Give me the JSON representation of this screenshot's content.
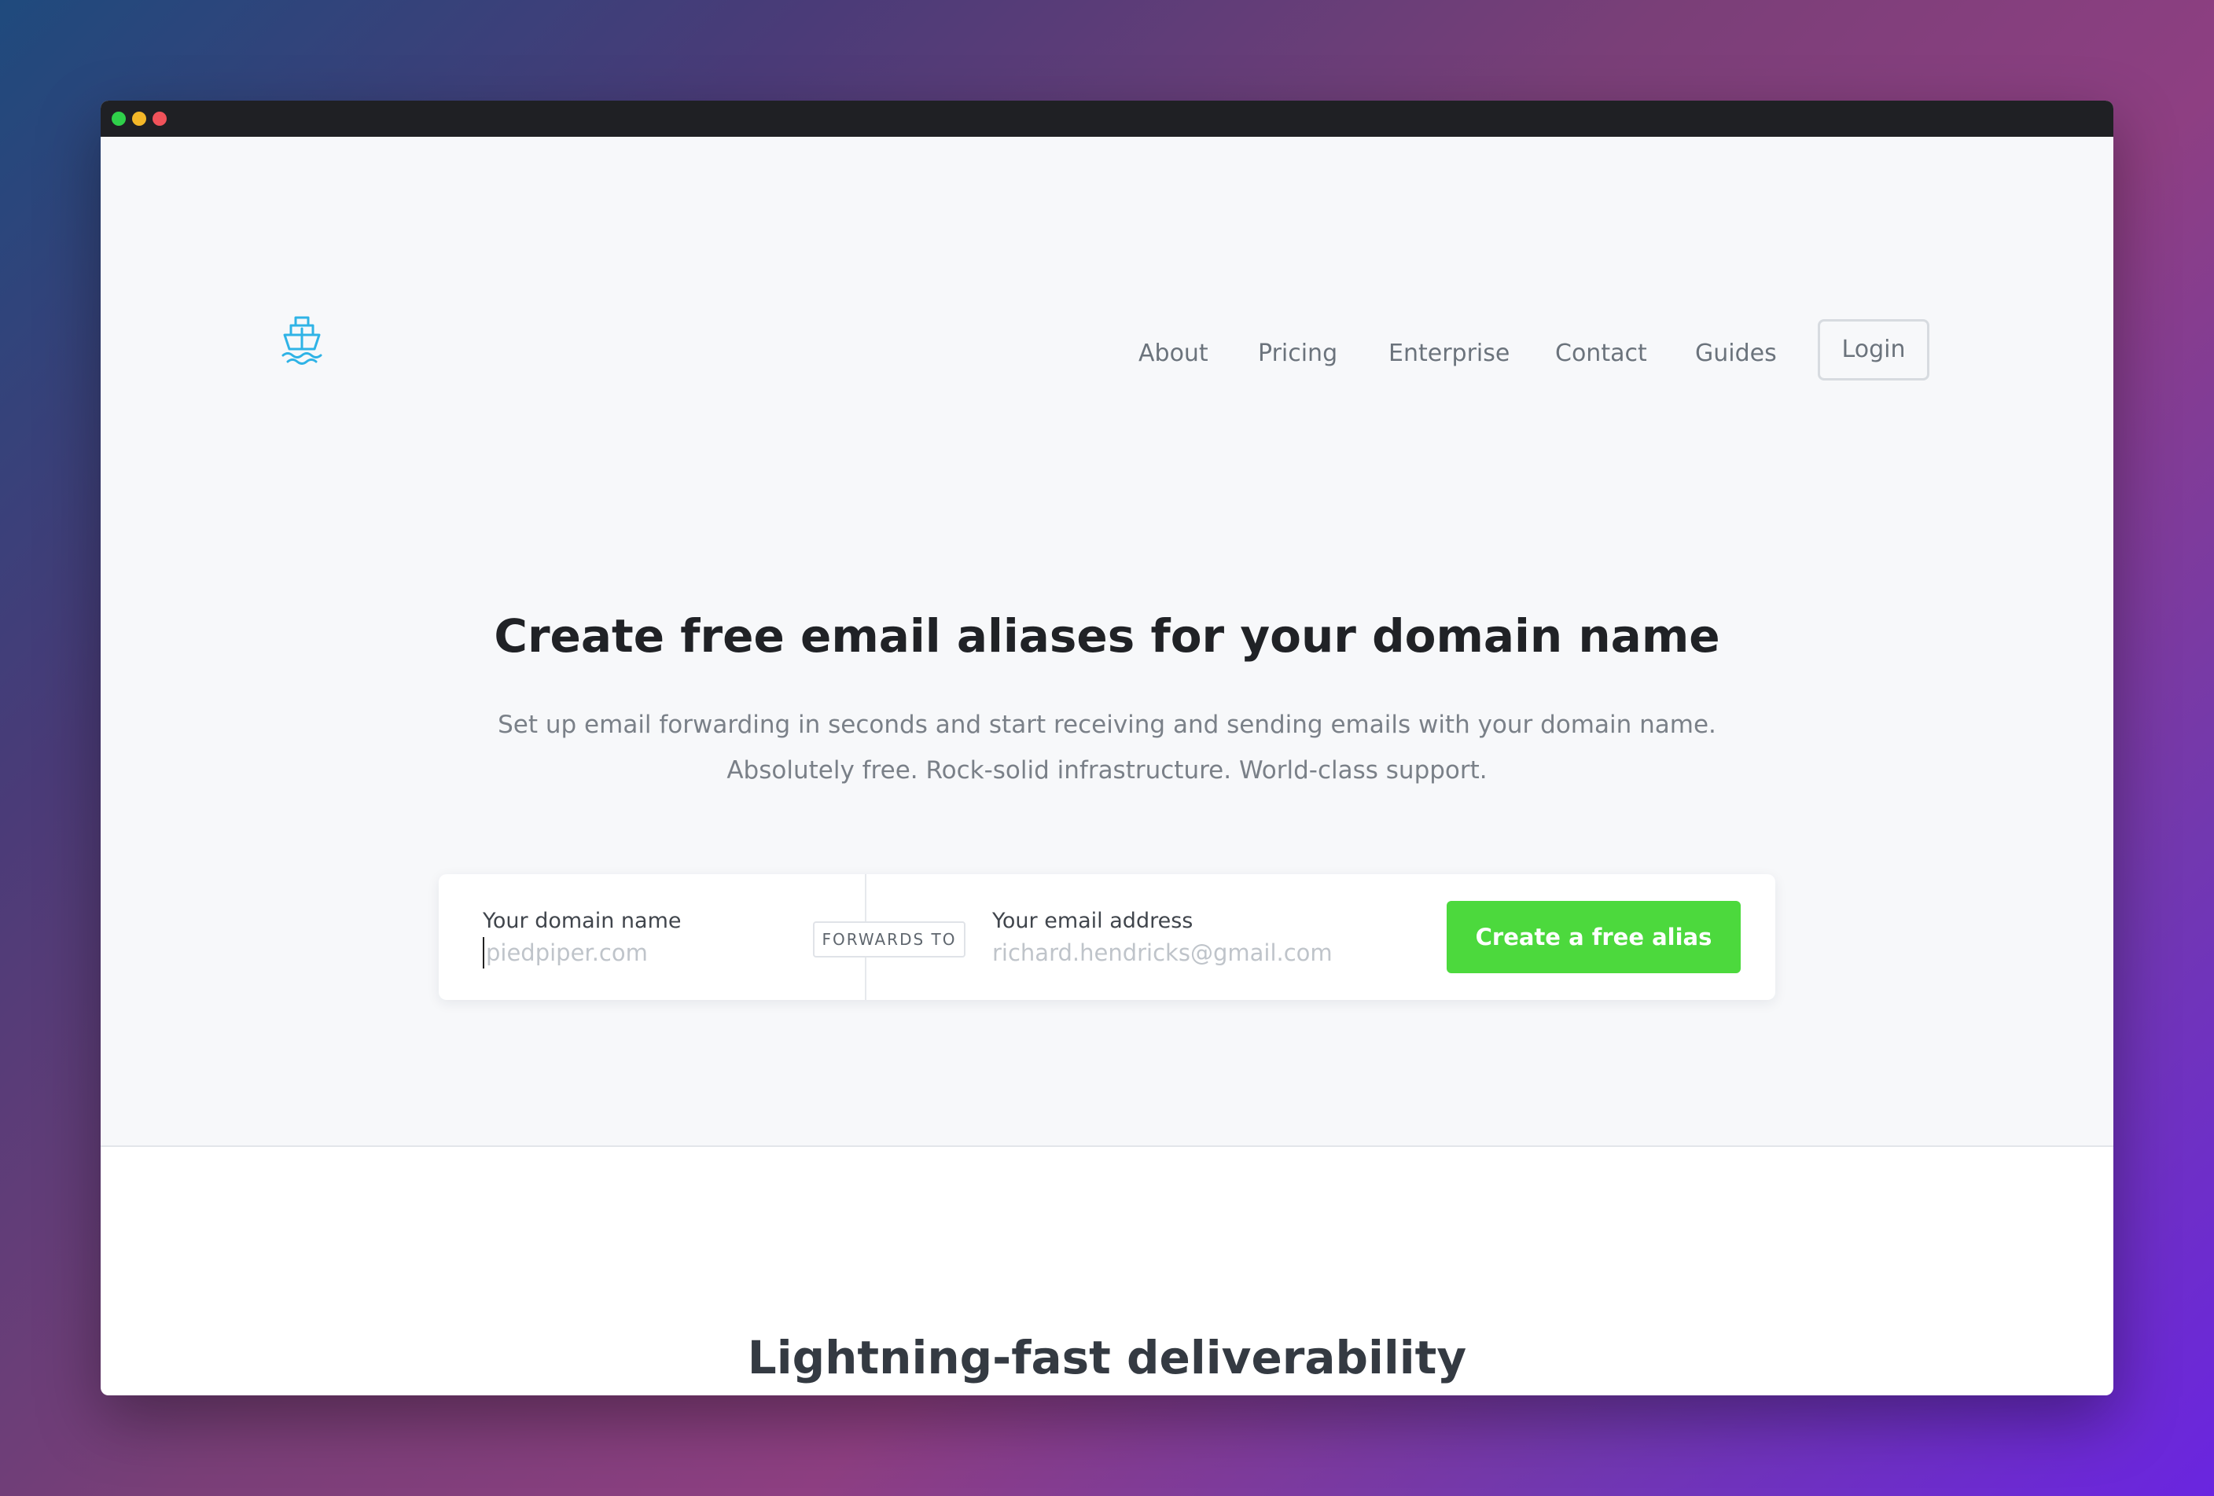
{
  "window": {
    "controls": [
      "green",
      "yellow",
      "red"
    ]
  },
  "header": {
    "logo_icon": "ship-icon",
    "nav": [
      {
        "label": "About"
      },
      {
        "label": "Pricing"
      },
      {
        "label": "Enterprise"
      },
      {
        "label": "Contact"
      },
      {
        "label": "Guides"
      }
    ],
    "login_label": "Login"
  },
  "hero": {
    "title": "Create free email aliases for your domain name",
    "subtitle_line1": "Set up email forwarding in seconds and start receiving and sending emails with your domain name.",
    "subtitle_line2": "Absolutely free. Rock-solid infrastructure. World-class support."
  },
  "form": {
    "domain_label": "Your domain name",
    "domain_placeholder": "piedpiper.com",
    "forwards_label": "FORWARDS TO",
    "email_label": "Your email address",
    "email_placeholder": "richard.hendricks@gmail.com",
    "submit_label": "Create a free alias"
  },
  "features": {
    "heading": "Lightning-fast deliverability"
  },
  "colors": {
    "accent": "#4cd93d",
    "logo": "#2fb3e6",
    "title_bar": "#1f2024"
  }
}
